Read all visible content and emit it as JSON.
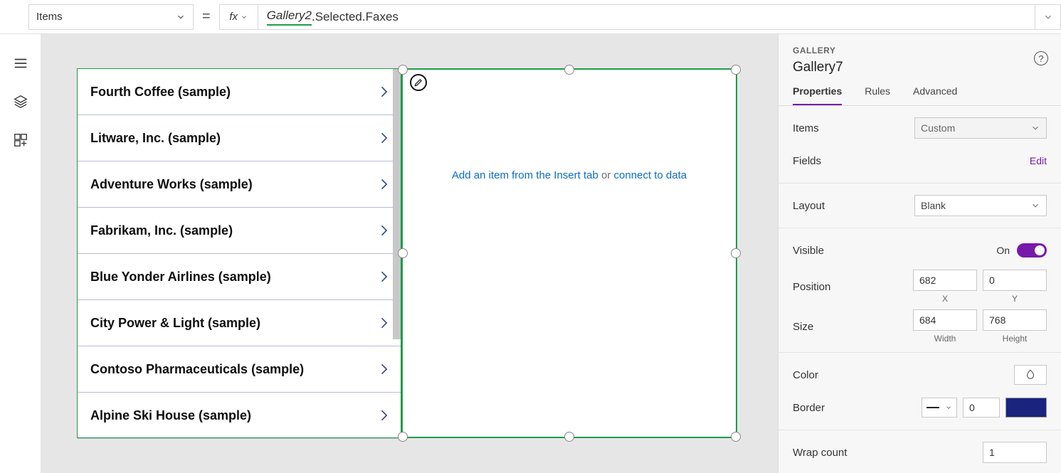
{
  "formula_bar": {
    "property": "Items",
    "equals": "=",
    "fx": "fx",
    "expr_prefix": "Gallery2",
    "expr_suffix": ".Selected.Faxes"
  },
  "canvas": {
    "list": [
      "Fourth Coffee (sample)",
      "Litware, Inc. (sample)",
      "Adventure Works (sample)",
      "Fabrikam, Inc. (sample)",
      "Blue Yonder Airlines (sample)",
      "City Power & Light (sample)",
      "Contoso Pharmaceuticals (sample)",
      "Alpine Ski House (sample)"
    ],
    "empty_msg": {
      "left": "Add an item from the Insert tab",
      "or": " or ",
      "right": "connect to data"
    }
  },
  "panel": {
    "category": "GALLERY",
    "name": "Gallery7",
    "tabs": {
      "properties": "Properties",
      "rules": "Rules",
      "advanced": "Advanced"
    },
    "items_label": "Items",
    "items_value": "Custom",
    "fields_label": "Fields",
    "fields_edit": "Edit",
    "layout_label": "Layout",
    "layout_value": "Blank",
    "visible_label": "Visible",
    "visible_value": "On",
    "position_label": "Position",
    "pos_x": "682",
    "pos_y": "0",
    "pos_x_lbl": "X",
    "pos_y_lbl": "Y",
    "size_label": "Size",
    "size_w": "684",
    "size_h": "768",
    "size_w_lbl": "Width",
    "size_h_lbl": "Height",
    "color_label": "Color",
    "border_label": "Border",
    "border_value": "0",
    "wrap_label": "Wrap count",
    "wrap_value": "1",
    "help": "?"
  }
}
